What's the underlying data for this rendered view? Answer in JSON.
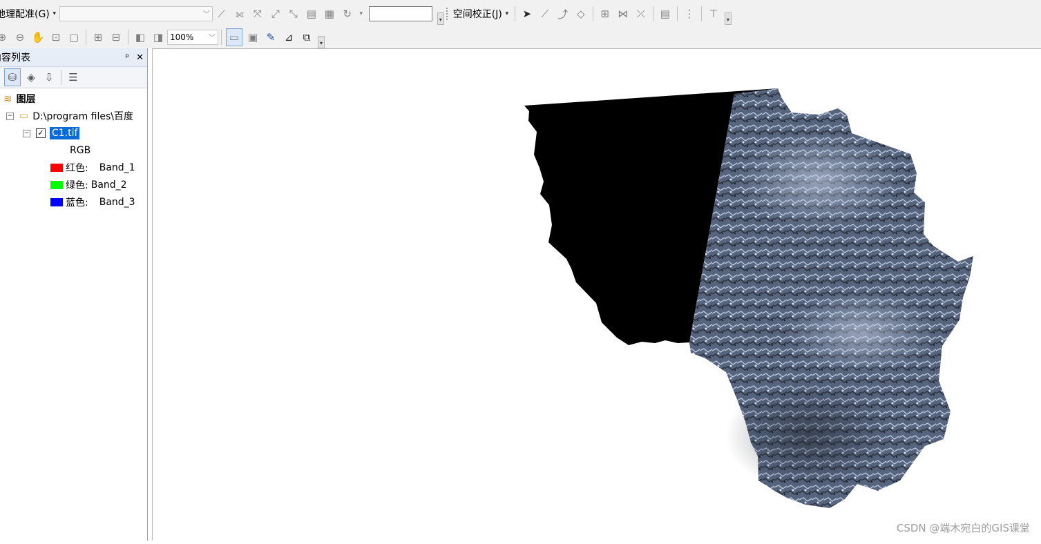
{
  "toolbar": {
    "georef_menu": "地理配准(G)",
    "spatial_adjust_menu": "空间校正(J)",
    "zoom_combo": "100%"
  },
  "toc": {
    "title": "内容列表",
    "pin": "ᵖ",
    "close": "✕",
    "root": "图层",
    "folder": "D:\\program files\\百度",
    "layer": "C1.tif",
    "rgb": "RGB",
    "bands": [
      {
        "label": "红色:",
        "band": "Band_1",
        "color": "#ff0000"
      },
      {
        "label": "绿色:",
        "band": "Band_2",
        "color": "#00ff00"
      },
      {
        "label": "蓝色:",
        "band": "Band_3",
        "color": "#0000ff"
      }
    ]
  },
  "watermark": "CSDN @端木宛白的GIS课堂",
  "colors": {
    "selection": "#0a6ad8",
    "nodata": "#000000",
    "imagery": "#5b6a85"
  }
}
